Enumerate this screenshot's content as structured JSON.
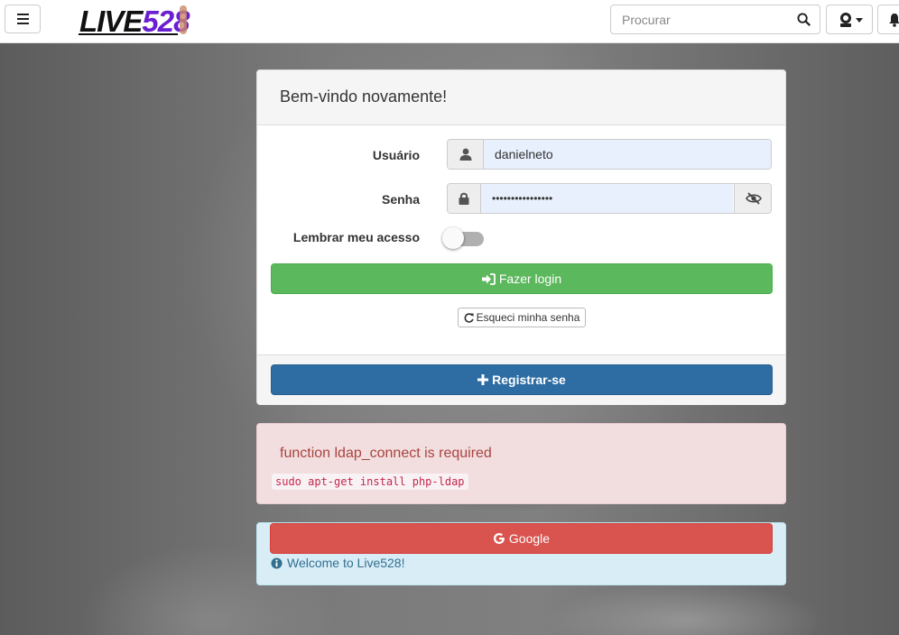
{
  "navbar": {
    "logo_text": "LIVE528",
    "search_placeholder": "Procurar"
  },
  "login": {
    "title": "Bem-vindo novamente!",
    "username_label": "Usuário",
    "username_value": "danielneto",
    "password_label": "Senha",
    "password_value": "••••••••••••••••",
    "remember_label": "Lembrar meu acesso",
    "remember_checked": false,
    "login_button": "Fazer login",
    "forgot_button": "Esqueci minha senha",
    "register_button": "Registrar-se"
  },
  "error_alert": {
    "message": "function ldap_connect is required",
    "command": "sudo apt-get install php-ldap"
  },
  "info_alert": {
    "google_button": "Google",
    "welcome_text": "Welcome to Live528!"
  },
  "colors": {
    "success": "#5cb85c",
    "primary": "#2e6da4",
    "danger": "#d9534f",
    "logo_purple": "#6a1fd1"
  }
}
